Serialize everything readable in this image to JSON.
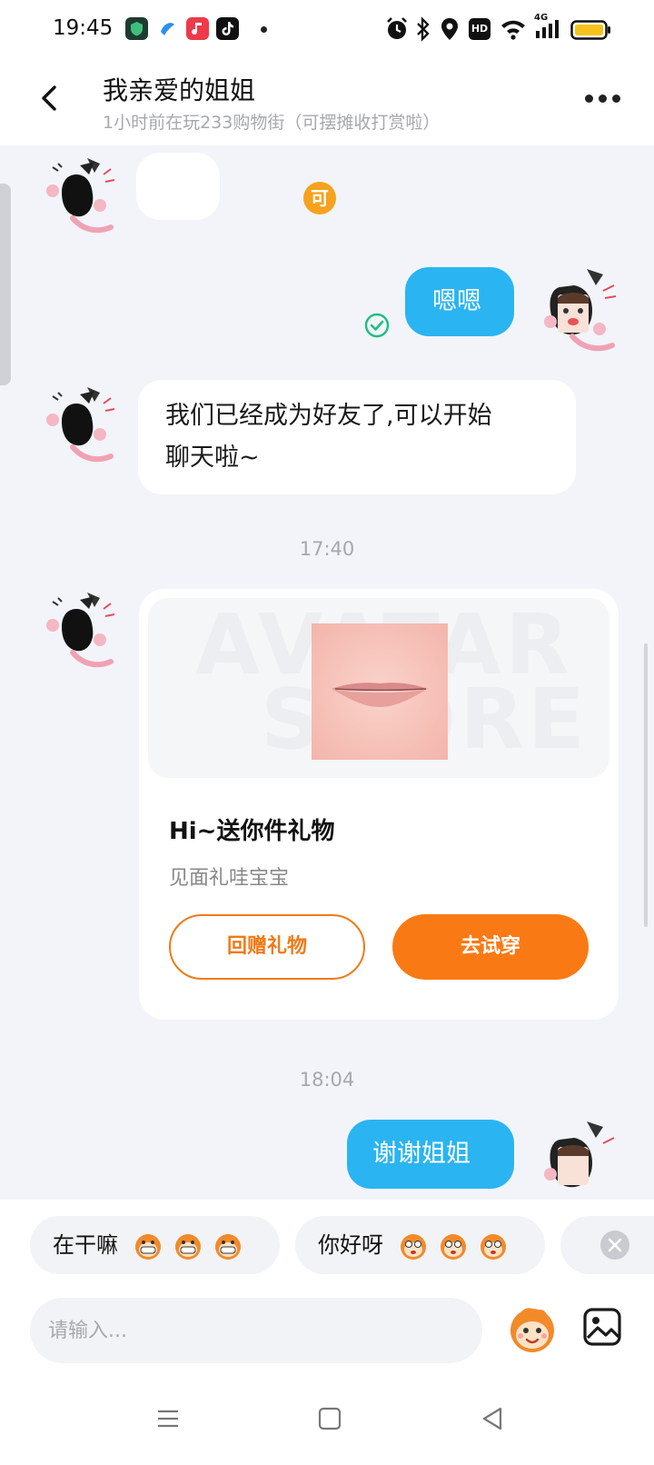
{
  "status_bar": {
    "time": "19:45",
    "app_icons": [
      "shield-app-icon",
      "blue-app-icon",
      "music-app-icon",
      "tiktok-icon"
    ],
    "right_icons": [
      "alarm-icon",
      "bluetooth-icon",
      "location-icon",
      "hd-icon",
      "wifi-icon",
      "4g-signal-icon",
      "battery-icon"
    ],
    "hd_label": "HD",
    "network_label": "4G"
  },
  "header": {
    "title": "我亲爱的姐姐",
    "subtitle": "1小时前在玩233购物街（可摆摊收打赏啦）"
  },
  "messages": {
    "m1_badge": "可",
    "m2_text": "嗯嗯",
    "m3_text_line1": "我们已经成为好友了,可以开始",
    "m3_text_line2": "聊天啦~",
    "time1": "17:40",
    "gift": {
      "watermark_line1": "AVATAR",
      "watermark_line2": "STORE",
      "title": "Hi~送你件礼物",
      "subtitle": "见面礼哇宝宝",
      "return_button": "回赠礼物",
      "try_button": "去试穿"
    },
    "time2": "18:04",
    "m5_text": "谢谢姐姐"
  },
  "quick_replies": [
    {
      "label": "在干嘛"
    },
    {
      "label": "你好呀"
    }
  ],
  "input": {
    "placeholder": "请输入..."
  },
  "colors": {
    "accent_orange": "#f97a14",
    "bubble_blue": "#2ab4f2",
    "background": "#f2f4f9"
  }
}
